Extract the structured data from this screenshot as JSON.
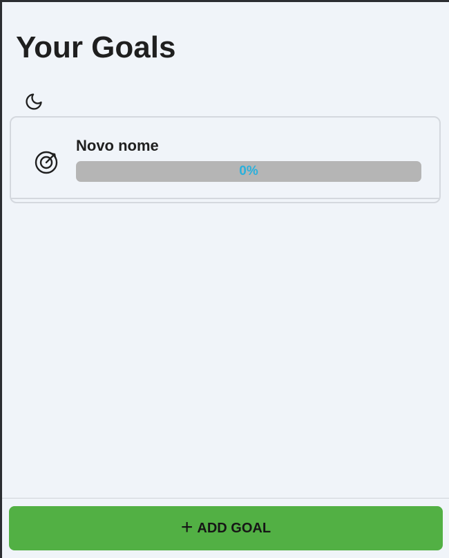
{
  "header": {
    "title": "Your Goals"
  },
  "theme_toggle": {
    "icon": "moon-icon"
  },
  "goals": [
    {
      "name": "Novo nome",
      "icon": "target-icon",
      "progress": 0,
      "progress_label": "0%"
    }
  ],
  "footer": {
    "add_icon": "plus-icon",
    "add_label": "ADD GOAL"
  },
  "colors": {
    "background": "#f0f4f9",
    "progress_track": "#b5b5b5",
    "progress_text": "#2ab0dc",
    "add_button": "#52b044",
    "card_border": "#d4d8de"
  }
}
